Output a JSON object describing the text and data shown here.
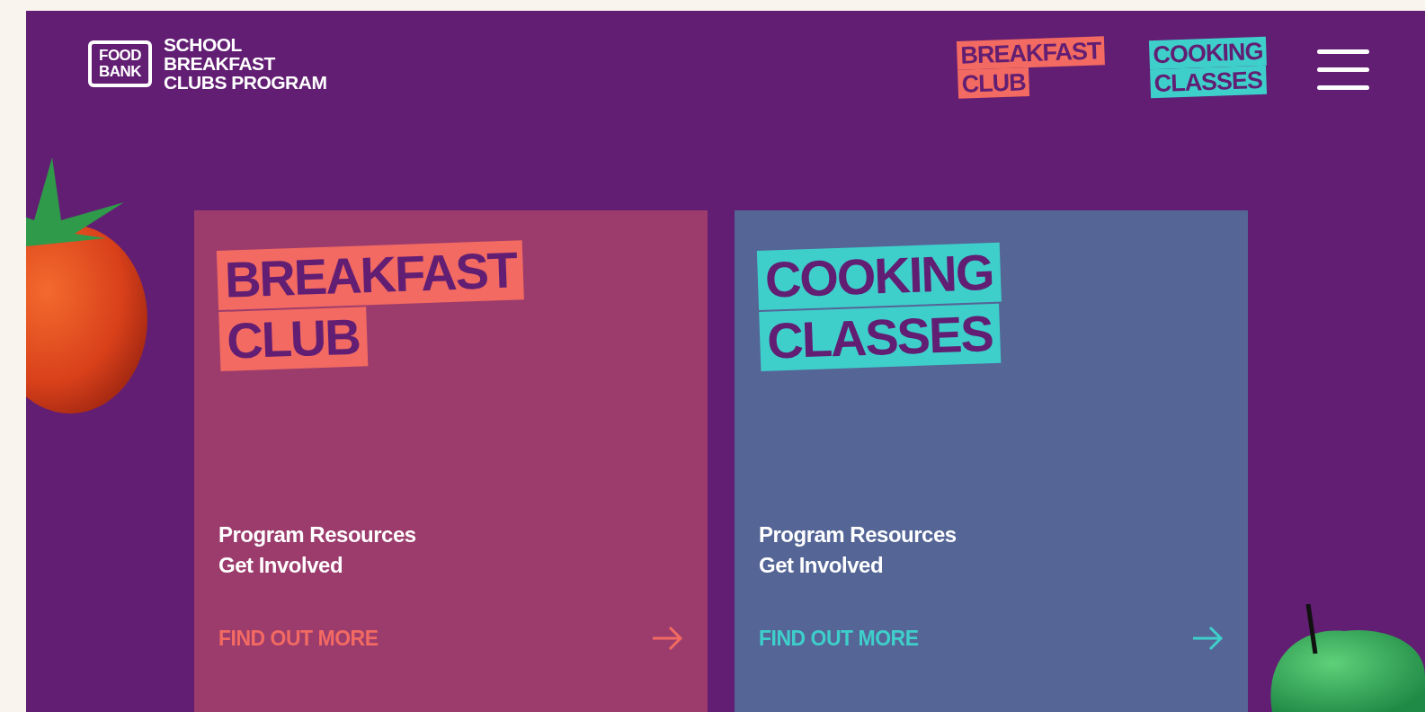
{
  "header": {
    "logo": {
      "mark_lines": [
        "FOOD",
        "BANK"
      ],
      "name_lines": [
        "SCHOOL",
        "BREAKFAST",
        "CLUBS PROGRAM"
      ]
    },
    "nav": [
      {
        "lines": [
          "BREAKFAST",
          "CLUB"
        ],
        "color": "#f26a62"
      },
      {
        "lines": [
          "COOKING",
          "CLASSES"
        ],
        "color": "#3fcfcb"
      }
    ]
  },
  "cards": [
    {
      "title_lines": [
        "BREAKFAST",
        "CLUB"
      ],
      "color": "#f26a62",
      "links": [
        "Program Resources",
        "Get Involved"
      ],
      "cta": "FIND OUT MORE"
    },
    {
      "title_lines": [
        "COOKING",
        "CLASSES"
      ],
      "color": "#3fcfcb",
      "links": [
        "Program Resources",
        "Get Involved"
      ],
      "cta": "FIND OUT MORE"
    }
  ]
}
